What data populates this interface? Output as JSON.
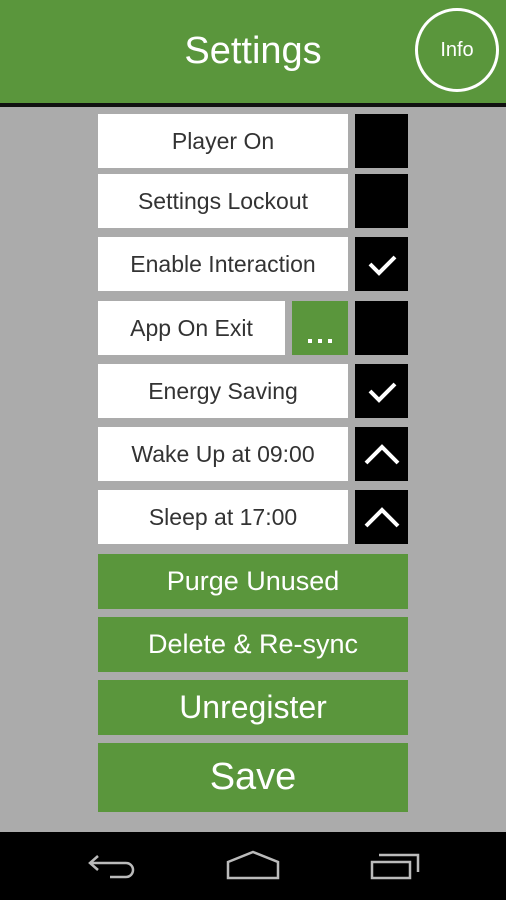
{
  "header": {
    "title": "Settings",
    "info_label": "Info"
  },
  "settings": [
    {
      "label": "Player On",
      "control": "checkbox",
      "checked": false
    },
    {
      "label": "Settings Lockout",
      "control": "checkbox",
      "checked": false
    },
    {
      "label": "Enable Interaction",
      "control": "checkbox",
      "checked": true
    },
    {
      "label": "App On Exit",
      "control": "checkbox",
      "checked": false,
      "extra_button": "more-options"
    },
    {
      "label": "Energy Saving",
      "control": "checkbox",
      "checked": true
    },
    {
      "label": "Wake Up at 09:00",
      "control": "expand",
      "icon": "chevron-up-icon"
    },
    {
      "label": "Sleep at 17:00",
      "control": "expand",
      "icon": "chevron-up-icon"
    }
  ],
  "actions": {
    "purge": "Purge Unused",
    "delete_resync": "Delete & Re-sync",
    "unregister": "Unregister",
    "save": "Save"
  },
  "navbar": {
    "back": "back-icon",
    "home": "home-icon",
    "recents": "recents-icon"
  },
  "colors": {
    "accent": "#5a963c",
    "background": "#ababab",
    "checkbox": "#000000"
  }
}
